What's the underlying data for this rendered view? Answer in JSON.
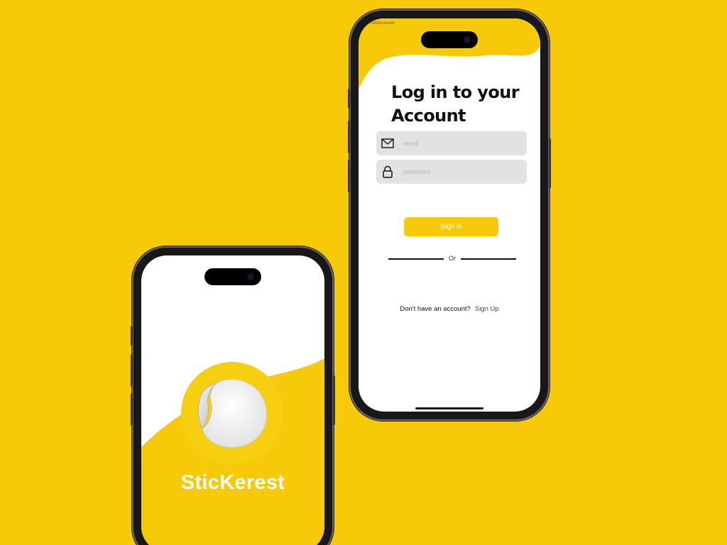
{
  "login": {
    "status_text": "Photoscanner",
    "title": "Log in to your Account",
    "email": {
      "placeholder": "email",
      "value": "",
      "icon": "envelope-icon"
    },
    "password": {
      "placeholder": "password",
      "value": "",
      "icon": "lock-icon"
    },
    "signin_label": "Sign in",
    "divider_text": "Or",
    "no_account_text": "Don't have an account?",
    "signup_label": "Sign Up"
  },
  "splash": {
    "app_name": "SticKerest",
    "logo_icon": "sticker-icon"
  },
  "colors": {
    "background": "#f6c909",
    "accent": "#f6c909",
    "link": "#2a3fcf",
    "field_bg": "#e2e2e2"
  }
}
